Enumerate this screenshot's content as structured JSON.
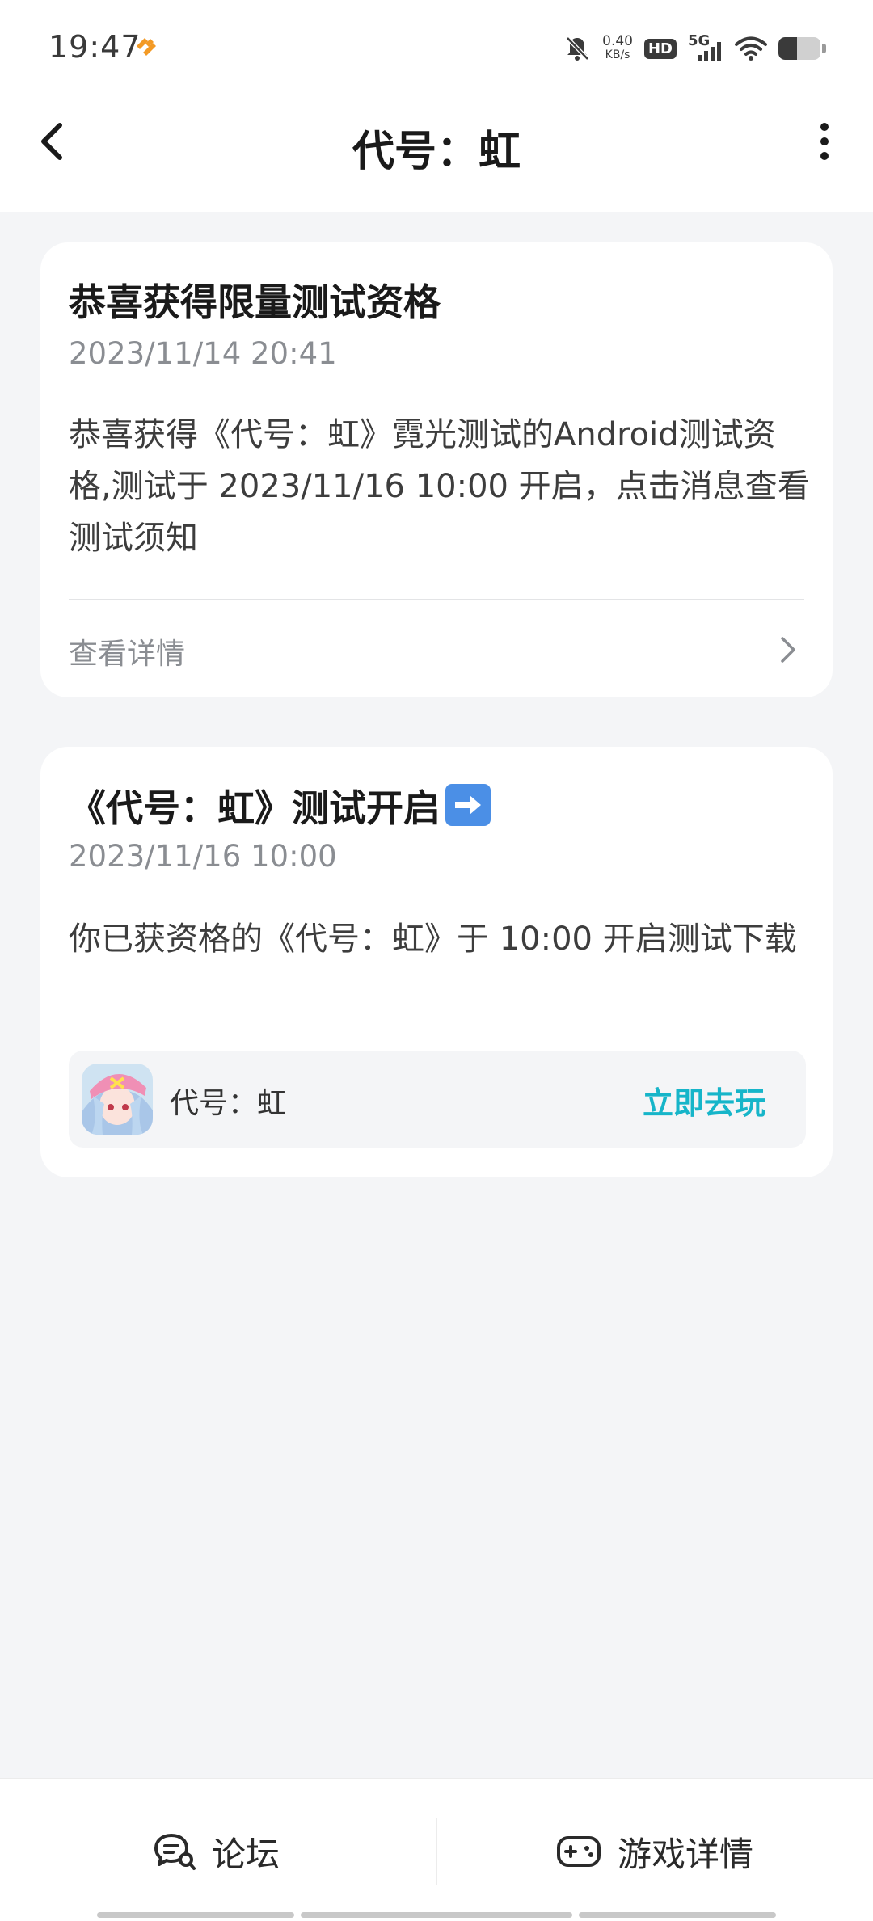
{
  "status_bar": {
    "time": "19:47",
    "net_speed_value": "0.40",
    "net_speed_unit": "KB/s",
    "hd_label": "HD",
    "network_label": "5G",
    "battery_level": 0.45,
    "icons": [
      "brand-heart-icon",
      "mute-bell-icon",
      "signal-icon",
      "wifi-icon",
      "battery-icon"
    ]
  },
  "header": {
    "title": "代号：虹",
    "back_icon": "back-chevron-icon",
    "more_icon": "more-vertical-icon"
  },
  "messages": [
    {
      "title": "恭喜获得限量测试资格",
      "date": "2023/11/14 20:41",
      "body": "恭喜获得《代号：虹》霓光测试的Android测试资格,测试于 2023/11/16 10:00 开启，点击消息查看测试须知",
      "detail_label": "查看详情"
    },
    {
      "title": "《代号：虹》测试开启",
      "title_emoji": "right-arrow-emoji-icon",
      "date": "2023/11/16 10:00",
      "body": "你已获资格的《代号：虹》于 10:00 开启测试下载",
      "game": {
        "name": "代号：虹",
        "action_label": "立即去玩"
      }
    }
  ],
  "bottom_bar": {
    "forum_label": "论坛",
    "game_detail_label": "游戏详情"
  },
  "colors": {
    "accent": "#16b5c9",
    "page_bg": "#f4f5f7",
    "brand_orange": "#f39a25"
  }
}
